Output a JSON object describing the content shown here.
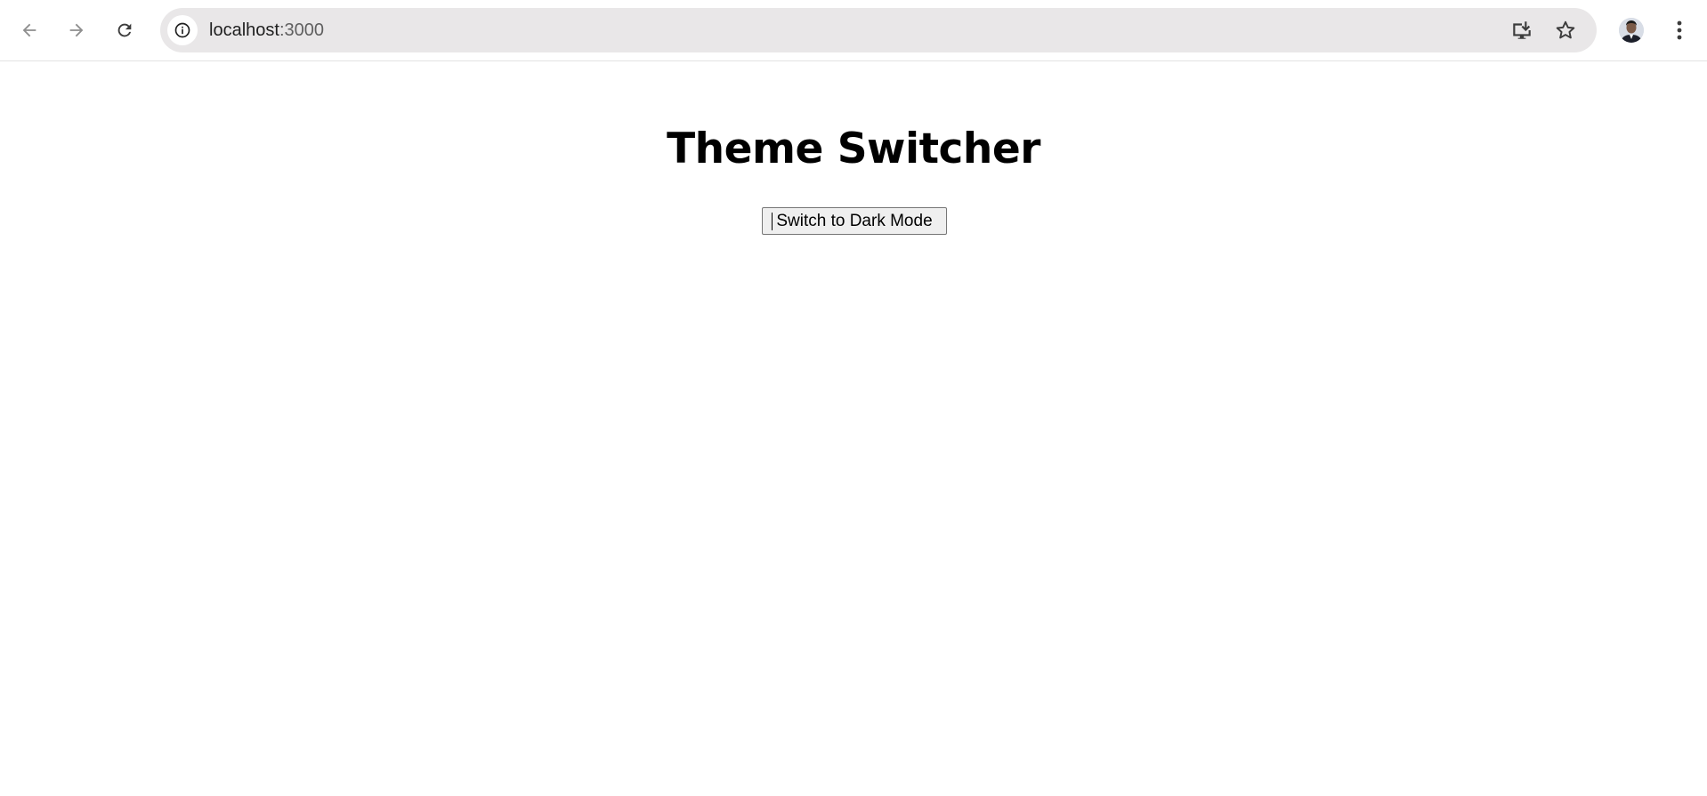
{
  "browser": {
    "url_host": "localhost",
    "url_port": ":3000",
    "icons": {
      "back": "arrow-left-icon",
      "forward": "arrow-right-icon",
      "reload": "reload-icon",
      "site_info": "info-icon",
      "install": "install-app-icon",
      "bookmark": "star-icon",
      "profile": "avatar",
      "menu": "kebab-menu-icon"
    }
  },
  "page": {
    "heading": "Theme Switcher",
    "toggle_button_label": "Switch to Dark Mode"
  },
  "colors": {
    "page_background": "#ffffff",
    "heading_text": "#000000",
    "button_background": "#efefef",
    "button_border": "#767676",
    "omnibox_background": "#e9e7e8"
  }
}
